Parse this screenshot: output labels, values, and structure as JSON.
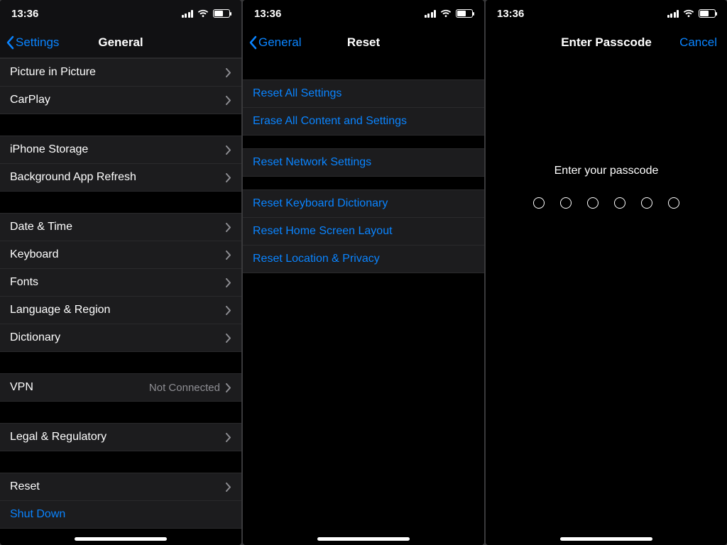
{
  "status_time": "13:36",
  "screen1": {
    "back": "Settings",
    "title": "General",
    "group1": [
      "Picture in Picture",
      "CarPlay"
    ],
    "group2": [
      "iPhone Storage",
      "Background App Refresh"
    ],
    "group3": [
      "Date & Time",
      "Keyboard",
      "Fonts",
      "Language & Region",
      "Dictionary"
    ],
    "group4_label": "VPN",
    "group4_detail": "Not Connected",
    "group5": [
      "Legal & Regulatory"
    ],
    "group6_reset": "Reset",
    "group6_shutdown": "Shut Down"
  },
  "screen2": {
    "back": "General",
    "title": "Reset",
    "group1": [
      "Reset All Settings",
      "Erase All Content and Settings"
    ],
    "group2": [
      "Reset Network Settings"
    ],
    "group3": [
      "Reset Keyboard Dictionary",
      "Reset Home Screen Layout",
      "Reset Location & Privacy"
    ]
  },
  "screen3": {
    "title": "Enter Passcode",
    "cancel": "Cancel",
    "prompt": "Enter your passcode",
    "dot_count": 6
  }
}
